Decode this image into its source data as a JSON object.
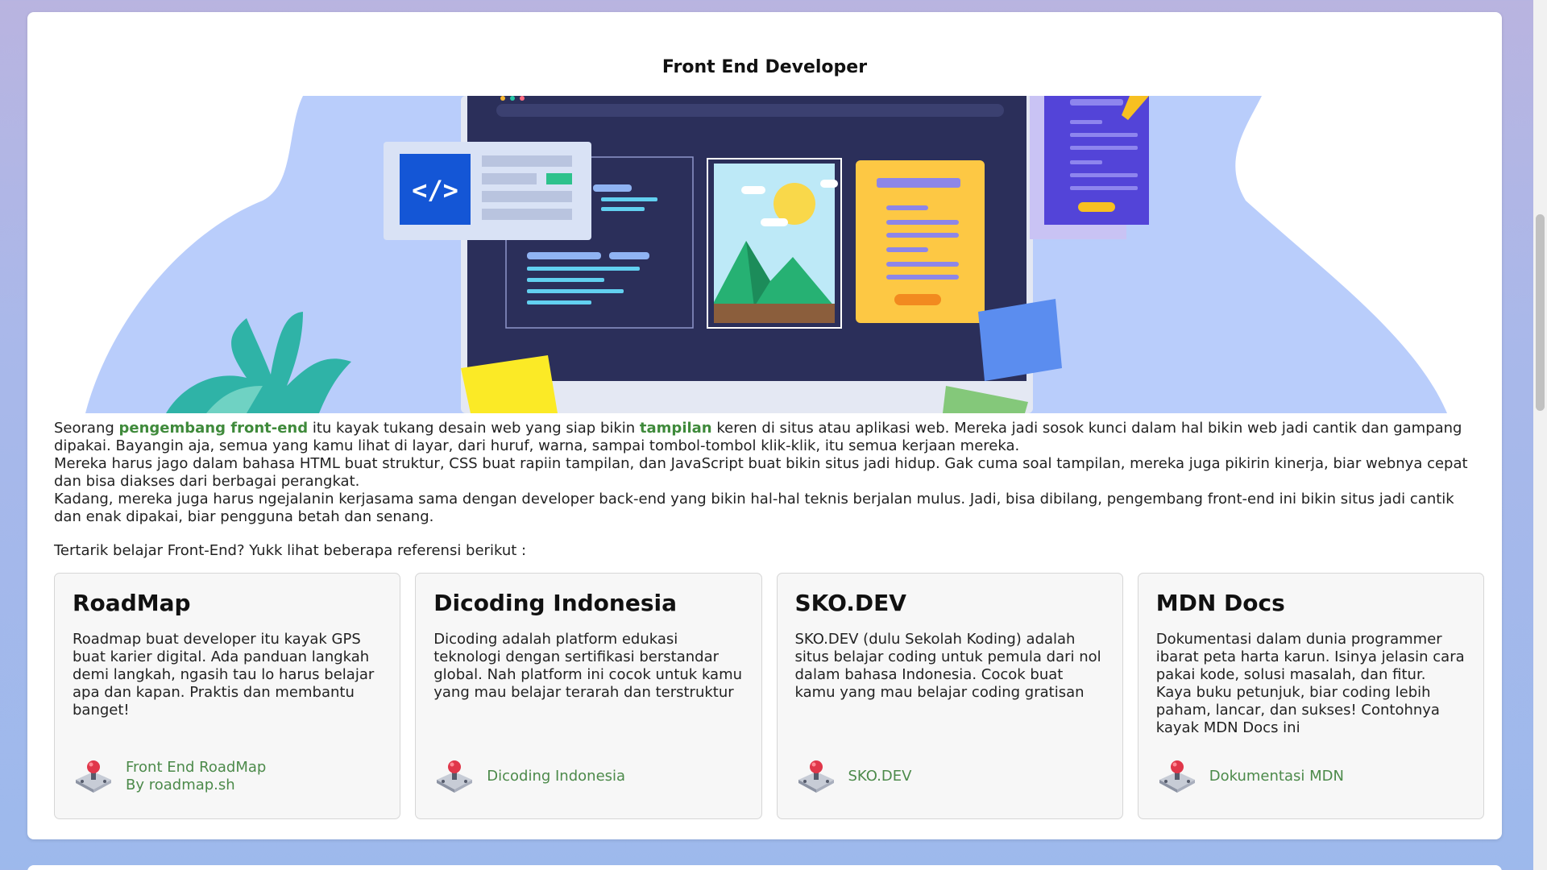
{
  "page": {
    "title": "Front End Developer"
  },
  "intro": {
    "p1_a": "Seorang ",
    "p1_hl1": "pengembang front-end",
    "p1_b": " itu kayak tukang desain web yang siap bikin ",
    "p1_hl2": "tampilan",
    "p1_c": " keren di situs atau aplikasi web. Mereka jadi sosok kunci dalam hal bikin web jadi cantik dan gampang dipakai. Bayangin aja, semua yang kamu lihat di layar, dari huruf, warna, sampai tombol-tombol klik-klik, itu semua kerjaan mereka.",
    "p2": "Mereka harus jago dalam bahasa HTML buat struktur, CSS buat rapiin tampilan, dan JavaScript buat bikin situs jadi hidup. Gak cuma soal tampilan, mereka juga pikirin kinerja, biar webnya cepat dan bisa diakses dari berbagai perangkat.",
    "p3": "Kadang, mereka juga harus ngejalanin kerjasama sama dengan developer back-end yang bikin hal-hal teknis berjalan mulus. Jadi, bisa dibilang, pengembang front-end ini bikin situs jadi cantik dan enak dipakai, biar pengguna betah dan senang."
  },
  "references": {
    "intro": "Tertarik belajar Front-End? Yukk lihat beberapa referensi berikut :",
    "cards": [
      {
        "title": "RoadMap",
        "description": "Roadmap buat developer itu kayak GPS buat karier digital. Ada panduan langkah demi langkah, ngasih tau lo harus belajar apa dan kapan. Praktis dan membantu banget!",
        "link_line1": "Front End RoadMap",
        "link_line2": "By roadmap.sh",
        "icon": "joystick-icon"
      },
      {
        "title": "Dicoding Indonesia",
        "description": "Dicoding adalah platform edukasi teknologi dengan sertifikasi berstandar global. Nah platform ini cocok untuk kamu yang mau belajar terarah dan terstruktur",
        "link_line1": "Dicoding Indonesia",
        "link_line2": "",
        "icon": "joystick-icon"
      },
      {
        "title": "SKO.DEV",
        "description": "SKO.DEV (dulu Sekolah Koding) adalah situs belajar coding untuk pemula dari nol dalam bahasa Indonesia. Cocok buat kamu yang mau belajar coding gratisan",
        "link_line1": "SKO.DEV",
        "link_line2": "",
        "icon": "joystick-icon"
      },
      {
        "title": "MDN Docs",
        "description": "Dokumentasi dalam dunia programmer ibarat peta harta karun. Isinya jelasin cara pakai kode, solusi masalah, dan fitur. Kaya buku petunjuk, biar coding lebih paham, lancar, dan sukses! Contohnya kayak MDN Docs ini",
        "link_line1": "Dokumentasi MDN",
        "link_line2": "",
        "icon": "joystick-icon"
      }
    ]
  },
  "colors": {
    "accent_green": "#3f8a3b",
    "link_green": "#4c8a4a",
    "hero_blob": "#b9cdfb",
    "laptop_screen": "#2b2f5a"
  }
}
